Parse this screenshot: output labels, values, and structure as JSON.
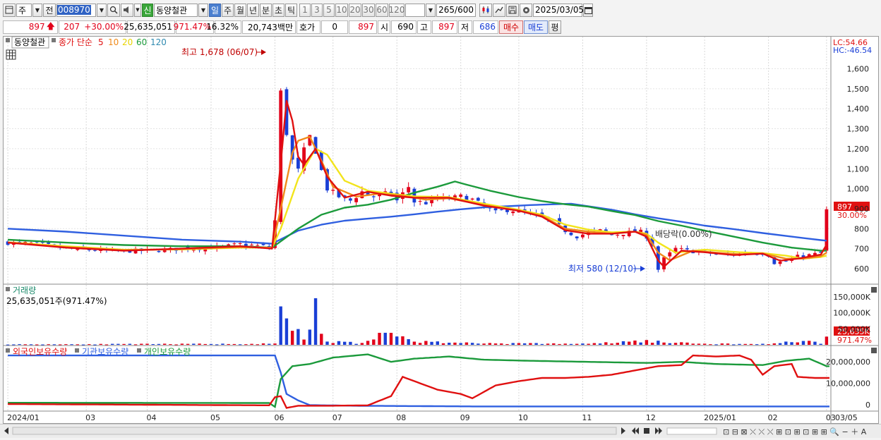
{
  "toolbar": {
    "market_label": "주",
    "prev_label": "전",
    "code": "008970",
    "new_badge": "신",
    "stock_name": "동양철관",
    "periods": [
      "일",
      "주",
      "월",
      "년",
      "분",
      "초",
      "틱"
    ],
    "active_period": "일",
    "intervals": [
      "1",
      "3",
      "5",
      "10",
      "20",
      "30",
      "60",
      "120"
    ],
    "count": "265",
    "count_max": "/600",
    "date": "2025/03/05"
  },
  "quote": {
    "price": "897",
    "change": "207",
    "change_pct": "+30.00%",
    "volume": "25,635,051",
    "volume_pct": "971.47%",
    "turnover": "16.32%",
    "amount": "20,743백만",
    "hoga_label": "호가",
    "hoga_value": "0",
    "hoga_price": "897",
    "open_label": "시",
    "open": "690",
    "high_label": "고",
    "high": "897",
    "low_label": "저",
    "low": "686",
    "buy_label": "매수",
    "sell_label": "매도",
    "eval_label": "평"
  },
  "price_panel": {
    "name_tag": "동양철관",
    "ma_title": "종가 단순",
    "ma_periods": [
      "5",
      "10",
      "20",
      "60",
      "120"
    ],
    "lc": "LC:54.66",
    "hc": "HC:-46.54",
    "high_note": "최고 1,678 (06/07)",
    "low_note": "최저 580 (12/10)",
    "dividend_note": "배당락(0.00%)",
    "current_price_tag": "897",
    "current_pct_tag": "30.00%",
    "y_ticks": [
      "1,600",
      "1,500",
      "1,400",
      "1,300",
      "1,200",
      "1,100",
      "1,000",
      "900",
      "800",
      "700",
      "600"
    ]
  },
  "volume_panel": {
    "title": "거래량",
    "value": "25,635,051주(971.47%)",
    "y_ticks": [
      "150,000K",
      "100,000K",
      "50,000K"
    ],
    "current_tag": "25,635K",
    "current_pct": "971.47%"
  },
  "holdings_panel": {
    "legend": [
      "외국인보유수량",
      "기관보유수량",
      "개인보유수량"
    ],
    "y_ticks": [
      "20,000,000",
      "10,000,000",
      "0"
    ]
  },
  "x_axis": {
    "labels": [
      "2024/01",
      "03",
      "04",
      "05",
      "06",
      "07",
      "08",
      "09",
      "10",
      "11",
      "12",
      "2025/01",
      "02",
      "03"
    ],
    "right_label": "03/05"
  },
  "chart_data": {
    "type": "candlestick",
    "price_range": [
      540,
      1690
    ],
    "price_high": {
      "value": 1678,
      "date": "06/07"
    },
    "price_low": {
      "value": 580,
      "date": "12/10"
    },
    "last_close": 897,
    "months": [
      "2024/01",
      "03",
      "04",
      "05",
      "06",
      "07",
      "08",
      "09",
      "10",
      "11",
      "12",
      "2025/01",
      "02",
      "03"
    ],
    "close_trend": [
      [
        0,
        730
      ],
      [
        5,
        725
      ],
      [
        10,
        700
      ],
      [
        18,
        688
      ],
      [
        25,
        690
      ],
      [
        30,
        700
      ],
      [
        36,
        705
      ],
      [
        40,
        722
      ],
      [
        44,
        712
      ],
      [
        45.5,
        700
      ],
      [
        46,
        840
      ],
      [
        46.5,
        1500
      ],
      [
        47,
        1480
      ],
      [
        48,
        1280
      ],
      [
        49,
        1140
      ],
      [
        50,
        1090
      ],
      [
        51,
        1190
      ],
      [
        52,
        1260
      ],
      [
        53,
        1190
      ],
      [
        54,
        1090
      ],
      [
        55,
        1000
      ],
      [
        57,
        960
      ],
      [
        59,
        940
      ],
      [
        61,
        985
      ],
      [
        63,
        960
      ],
      [
        66,
        980
      ],
      [
        67,
        940
      ],
      [
        69,
        1010
      ],
      [
        70,
        935
      ],
      [
        72,
        930
      ],
      [
        74,
        950
      ],
      [
        76,
        950
      ],
      [
        78,
        960
      ],
      [
        80,
        945
      ],
      [
        82,
        910
      ],
      [
        84,
        880
      ],
      [
        86,
        895
      ],
      [
        88,
        890
      ],
      [
        90,
        870
      ],
      [
        92,
        860
      ],
      [
        94,
        835
      ],
      [
        96,
        790
      ],
      [
        98,
        762
      ],
      [
        100,
        780
      ],
      [
        102,
        790
      ],
      [
        104,
        768
      ],
      [
        106,
        778
      ],
      [
        108,
        785
      ],
      [
        109.5,
        782
      ],
      [
        111,
        720
      ],
      [
        112,
        595
      ],
      [
        113,
        650
      ],
      [
        115,
        700
      ],
      [
        117,
        690
      ],
      [
        120,
        680
      ],
      [
        122,
        672
      ],
      [
        124,
        670
      ],
      [
        126,
        675
      ],
      [
        128,
        680
      ],
      [
        130,
        677
      ],
      [
        131,
        668
      ],
      [
        132,
        630
      ],
      [
        134,
        636
      ],
      [
        136,
        660
      ],
      [
        138,
        668
      ],
      [
        139,
        673
      ],
      [
        140,
        678
      ],
      [
        140.5,
        690
      ],
      [
        141,
        897
      ]
    ],
    "ma": {
      "5": [
        [
          0,
          730
        ],
        [
          10,
          705
        ],
        [
          20,
          690
        ],
        [
          30,
          700
        ],
        [
          40,
          712
        ],
        [
          45.5,
          700
        ],
        [
          47,
          1130
        ],
        [
          48,
          1440
        ],
        [
          49,
          1340
        ],
        [
          50,
          1160
        ],
        [
          51,
          1120
        ],
        [
          53,
          1200
        ],
        [
          55,
          1060
        ],
        [
          58,
          955
        ],
        [
          62,
          985
        ],
        [
          66,
          965
        ],
        [
          70,
          955
        ],
        [
          76,
          955
        ],
        [
          82,
          915
        ],
        [
          88,
          890
        ],
        [
          92,
          860
        ],
        [
          96,
          792
        ],
        [
          100,
          775
        ],
        [
          104,
          775
        ],
        [
          108,
          785
        ],
        [
          110,
          760
        ],
        [
          112,
          640
        ],
        [
          113,
          610
        ],
        [
          116,
          690
        ],
        [
          120,
          682
        ],
        [
          125,
          668
        ],
        [
          130,
          675
        ],
        [
          133,
          640
        ],
        [
          136,
          650
        ],
        [
          140,
          670
        ],
        [
          141,
          720
        ]
      ],
      "10": [
        [
          0,
          730
        ],
        [
          10,
          708
        ],
        [
          20,
          692
        ],
        [
          30,
          698
        ],
        [
          40,
          708
        ],
        [
          45.5,
          705
        ],
        [
          47,
          900
        ],
        [
          49,
          1180
        ],
        [
          50,
          1240
        ],
        [
          52,
          1260
        ],
        [
          54,
          1140
        ],
        [
          56,
          1010
        ],
        [
          60,
          960
        ],
        [
          64,
          975
        ],
        [
          68,
          965
        ],
        [
          72,
          945
        ],
        [
          76,
          952
        ],
        [
          82,
          918
        ],
        [
          88,
          890
        ],
        [
          92,
          865
        ],
        [
          96,
          800
        ],
        [
          100,
          785
        ],
        [
          104,
          775
        ],
        [
          108,
          785
        ],
        [
          110,
          770
        ],
        [
          112,
          680
        ],
        [
          114,
          642
        ],
        [
          118,
          690
        ],
        [
          122,
          680
        ],
        [
          126,
          672
        ],
        [
          130,
          676
        ],
        [
          134,
          650
        ],
        [
          137,
          650
        ],
        [
          140,
          662
        ],
        [
          141,
          680
        ]
      ],
      "20": [
        [
          0,
          732
        ],
        [
          10,
          712
        ],
        [
          20,
          695
        ],
        [
          30,
          696
        ],
        [
          40,
          705
        ],
        [
          45.5,
          705
        ],
        [
          47,
          800
        ],
        [
          50,
          1050
        ],
        [
          53,
          1200
        ],
        [
          55,
          1170
        ],
        [
          58,
          1040
        ],
        [
          62,
          990
        ],
        [
          66,
          975
        ],
        [
          70,
          962
        ],
        [
          76,
          958
        ],
        [
          82,
          925
        ],
        [
          88,
          895
        ],
        [
          92,
          870
        ],
        [
          96,
          820
        ],
        [
          100,
          795
        ],
        [
          104,
          782
        ],
        [
          108,
          785
        ],
        [
          110,
          775
        ],
        [
          112,
          730
        ],
        [
          115,
          680
        ],
        [
          120,
          695
        ],
        [
          126,
          682
        ],
        [
          130,
          678
        ],
        [
          134,
          665
        ],
        [
          137,
          650
        ],
        [
          140,
          658
        ],
        [
          141,
          665
        ]
      ],
      "60": [
        [
          0,
          745
        ],
        [
          10,
          730
        ],
        [
          20,
          718
        ],
        [
          30,
          712
        ],
        [
          40,
          712
        ],
        [
          45.5,
          705
        ],
        [
          50,
          800
        ],
        [
          54,
          870
        ],
        [
          58,
          905
        ],
        [
          62,
          920
        ],
        [
          66,
          945
        ],
        [
          70,
          980
        ],
        [
          74,
          1010
        ],
        [
          77,
          1036
        ],
        [
          79,
          1020
        ],
        [
          83,
          990
        ],
        [
          88,
          958
        ],
        [
          92,
          938
        ],
        [
          96,
          922
        ],
        [
          100,
          910
        ],
        [
          104,
          888
        ],
        [
          108,
          868
        ],
        [
          112,
          838
        ],
        [
          116,
          815
        ],
        [
          120,
          790
        ],
        [
          125,
          760
        ],
        [
          130,
          730
        ],
        [
          135,
          705
        ],
        [
          140,
          690
        ],
        [
          141,
          690
        ]
      ],
      "120": [
        [
          0,
          800
        ],
        [
          10,
          785
        ],
        [
          20,
          765
        ],
        [
          30,
          745
        ],
        [
          40,
          735
        ],
        [
          45.5,
          725
        ],
        [
          50,
          790
        ],
        [
          54,
          820
        ],
        [
          58,
          840
        ],
        [
          62,
          850
        ],
        [
          66,
          860
        ],
        [
          70,
          872
        ],
        [
          74,
          885
        ],
        [
          78,
          897
        ],
        [
          82,
          907
        ],
        [
          86,
          912
        ],
        [
          90,
          918
        ],
        [
          94,
          922
        ],
        [
          97,
          925
        ],
        [
          100,
          912
        ],
        [
          104,
          895
        ],
        [
          108,
          872
        ],
        [
          112,
          852
        ],
        [
          116,
          835
        ],
        [
          120,
          815
        ],
        [
          125,
          798
        ],
        [
          130,
          778
        ],
        [
          135,
          760
        ],
        [
          140,
          743
        ],
        [
          141,
          740
        ]
      ]
    },
    "volume_scale_k": [
      0,
      170000
    ],
    "volume_k_trend": [
      [
        0,
        1500
      ],
      [
        46,
        3000
      ],
      [
        46.5,
        148000
      ],
      [
        47,
        120000
      ],
      [
        48,
        80000
      ],
      [
        49,
        30000
      ],
      [
        50,
        35000
      ],
      [
        51,
        25000
      ],
      [
        52,
        40000
      ],
      [
        53,
        110000
      ],
      [
        54,
        25000
      ],
      [
        55,
        10000
      ],
      [
        60,
        6000
      ],
      [
        65,
        30000
      ],
      [
        67,
        35000
      ],
      [
        70,
        10000
      ],
      [
        75,
        8000
      ],
      [
        80,
        5000
      ],
      [
        90,
        4000
      ],
      [
        100,
        3000
      ],
      [
        110,
        12000
      ],
      [
        115,
        6000
      ],
      [
        120,
        3000
      ],
      [
        130,
        2500
      ],
      [
        138,
        12000
      ],
      [
        140,
        5000
      ],
      [
        141,
        25635
      ]
    ],
    "holdings_scale": [
      -2000000,
      25000000
    ],
    "foreign_trend": [
      [
        0,
        300000
      ],
      [
        45,
        -300000
      ],
      [
        46,
        3500000
      ],
      [
        47,
        4000000
      ],
      [
        48,
        -1500000
      ],
      [
        50,
        -500000
      ],
      [
        55,
        -500000
      ],
      [
        62,
        -300000
      ],
      [
        66,
        4000000
      ],
      [
        68,
        13000000
      ],
      [
        70,
        11000000
      ],
      [
        72,
        9000000
      ],
      [
        74,
        7000000
      ],
      [
        78,
        5000000
      ],
      [
        80,
        3000000
      ],
      [
        84,
        9000000
      ],
      [
        88,
        11000000
      ],
      [
        92,
        12500000
      ],
      [
        96,
        12500000
      ],
      [
        100,
        13000000
      ],
      [
        104,
        14000000
      ],
      [
        108,
        16000000
      ],
      [
        112,
        18000000
      ],
      [
        116,
        18500000
      ],
      [
        118,
        23000000
      ],
      [
        122,
        22500000
      ],
      [
        126,
        23000000
      ],
      [
        128,
        21000000
      ],
      [
        130,
        14000000
      ],
      [
        132,
        18000000
      ],
      [
        135,
        19000000
      ],
      [
        136,
        13000000
      ],
      [
        139,
        12500000
      ],
      [
        141,
        12500000
      ]
    ],
    "institution_trend": [
      [
        0,
        23000000
      ],
      [
        46,
        23000000
      ],
      [
        47,
        15000000
      ],
      [
        48,
        5000000
      ],
      [
        50,
        2000000
      ],
      [
        52,
        -200000
      ],
      [
        60,
        -500000
      ],
      [
        80,
        -800000
      ],
      [
        141,
        -800000
      ]
    ],
    "individual_trend": [
      [
        0,
        900000
      ],
      [
        45,
        800000
      ],
      [
        46,
        -1000000
      ],
      [
        47,
        12000000
      ],
      [
        49,
        18000000
      ],
      [
        52,
        19000000
      ],
      [
        56,
        22000000
      ],
      [
        62,
        23500000
      ],
      [
        66,
        20000000
      ],
      [
        70,
        21500000
      ],
      [
        76,
        22500000
      ],
      [
        82,
        21000000
      ],
      [
        90,
        20500000
      ],
      [
        100,
        20000000
      ],
      [
        110,
        19500000
      ],
      [
        116,
        20000000
      ],
      [
        122,
        19000000
      ],
      [
        130,
        18500000
      ],
      [
        134,
        20500000
      ],
      [
        138,
        21500000
      ],
      [
        141,
        18000000
      ]
    ],
    "total_sessions": 142
  },
  "colors": {
    "up": "#e2001a",
    "down": "#1a3fd6",
    "ma5": "#e01010",
    "ma10": "#f08a1a",
    "ma20": "#f2e41c",
    "ma60": "#1b9a3b",
    "ma120": "#2f5fe0",
    "foreign": "#e01010",
    "institution": "#2f5fe0",
    "individual": "#1b9a3b"
  }
}
